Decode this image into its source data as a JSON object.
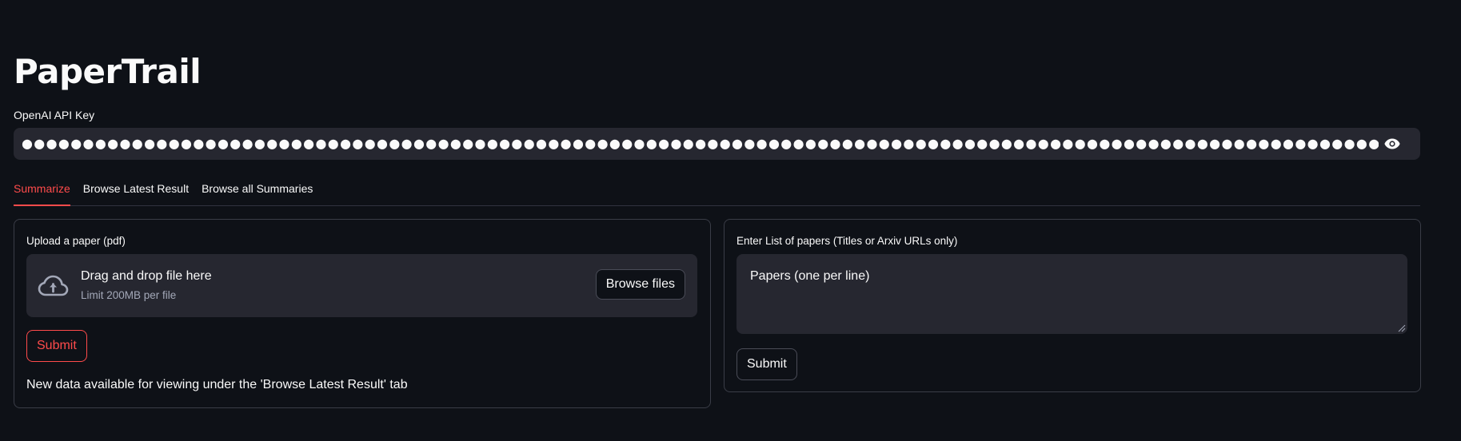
{
  "app": {
    "title": "PaperTrail"
  },
  "api_key": {
    "label": "OpenAI API Key",
    "value": "●●●●●●●●●●●●●●●●●●●●●●●●●●●●●●●●●●●●●●●●●●●●●●●●●●●●●●●●●●●●●●●●●●●●●●●●●●●●●●●●●●●●●●●●●●●●●●●●●●●●●●●●●●●●●●●●●●●●●●●●●●●●●●●",
    "toggle_icon": "eye-icon"
  },
  "tabs": [
    {
      "label": "Summarize",
      "active": true
    },
    {
      "label": "Browse Latest Result",
      "active": false
    },
    {
      "label": "Browse all Summaries",
      "active": false
    }
  ],
  "upload_panel": {
    "label": "Upload a paper (pdf)",
    "dropzone_title": "Drag and drop file here",
    "dropzone_limit": "Limit 200MB per file",
    "browse_label": "Browse files",
    "upload_icon": "cloud-upload-icon",
    "submit_label": "Submit",
    "status_message": "New data available for viewing under the 'Browse Latest Result' tab"
  },
  "list_panel": {
    "label": "Enter List of papers (Titles or Arxiv URLs only)",
    "textarea_placeholder": "Papers (one per line)",
    "submit_label": "Submit"
  },
  "colors": {
    "background": "#0e1117",
    "input_background": "#262730",
    "accent": "#ff4b4b",
    "text": "#fafafa"
  }
}
